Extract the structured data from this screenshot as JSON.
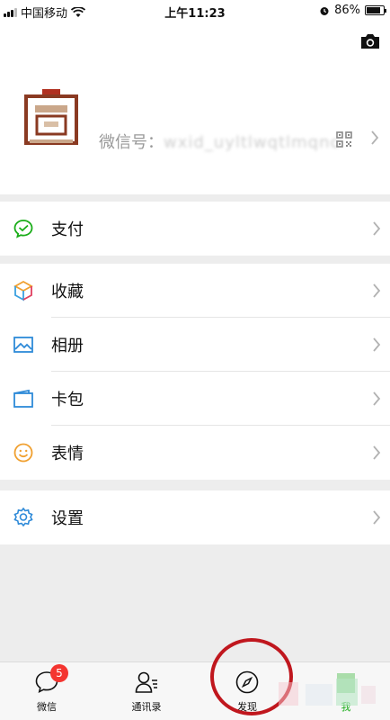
{
  "status_bar": {
    "carrier": "中国移动",
    "time": "上午11:23",
    "battery": "86%",
    "battery_level": 0.86
  },
  "profile": {
    "nickname": "",
    "wechat_id_label": "微信号：",
    "wechat_id_value": "wxid_uyltlwqtlmqnc"
  },
  "menu": {
    "pay": "支付",
    "favorites": "收藏",
    "album": "相册",
    "cards": "卡包",
    "stickers": "表情",
    "settings": "设置"
  },
  "tabs": {
    "chats": "微信",
    "chats_badge": "5",
    "contacts": "通讯录",
    "discover": "发现",
    "me": "我"
  },
  "colors": {
    "wechat_green": "#1aad19",
    "annotation_red": "#c0171e",
    "badge_red": "#f43530"
  }
}
